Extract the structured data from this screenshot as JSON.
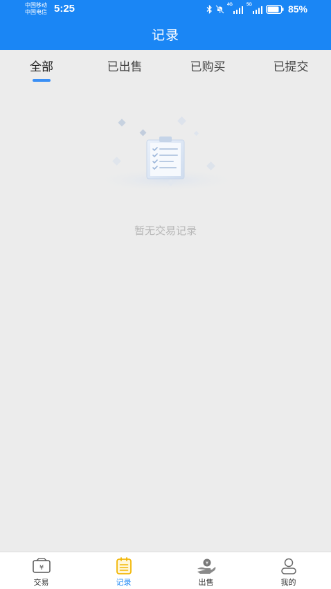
{
  "status_bar": {
    "carrier_1": "中国移动",
    "carrier_2": "中国电信",
    "time": "5:25",
    "network_1": "4G",
    "network_2": "5G",
    "battery": "85%"
  },
  "header": {
    "title": "记录"
  },
  "tabs": [
    {
      "label": "全部",
      "active": true
    },
    {
      "label": "已出售",
      "active": false
    },
    {
      "label": "已购买",
      "active": false
    },
    {
      "label": "已提交",
      "active": false
    }
  ],
  "empty_state": {
    "message": "暂无交易记录"
  },
  "bottom_nav": [
    {
      "label": "交易",
      "icon": "wallet-yen-icon",
      "active": false
    },
    {
      "label": "记录",
      "icon": "clipboard-list-icon",
      "active": true
    },
    {
      "label": "出售",
      "icon": "hand-coin-icon",
      "active": false
    },
    {
      "label": "我的",
      "icon": "user-icon",
      "active": false
    }
  ],
  "colors": {
    "primary": "#1a86f5",
    "background": "#ececec",
    "tab_indicator": "#3a8ff5",
    "empty_text": "#b7b7b7",
    "nav_active": "#1a86f5",
    "nav_active_icon": "#f2b705"
  }
}
